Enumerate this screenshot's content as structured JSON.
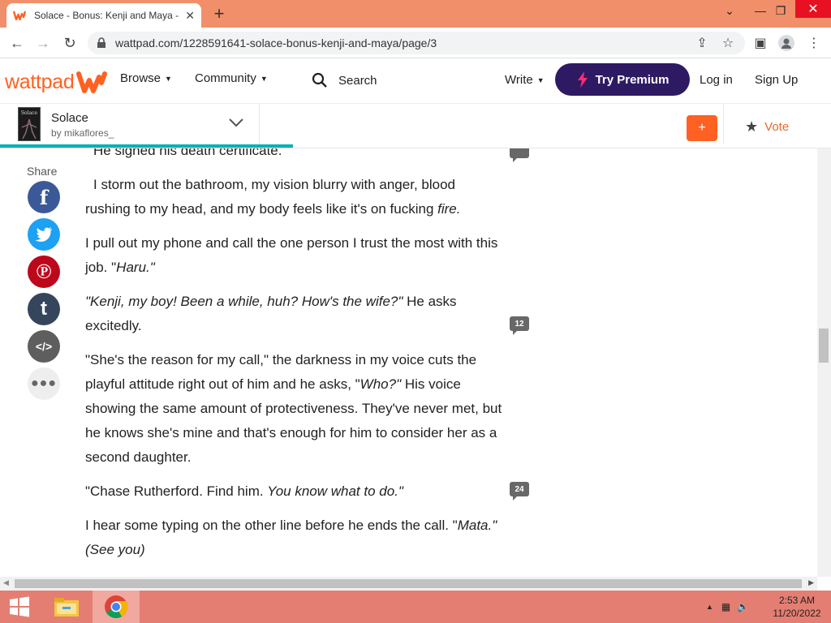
{
  "browser": {
    "tab_title": "Solace - Bonus: Kenji and Maya -",
    "tab_close": "✕",
    "new_tab": "+",
    "url": "wattpad.com/1228591641-solace-bonus-kenji-and-maya/page/3"
  },
  "header": {
    "logo": "wattpad",
    "browse": "Browse",
    "community": "Community",
    "search": "Search",
    "write": "Write",
    "premium": "Try Premium",
    "login": "Log in",
    "signup": "Sign Up"
  },
  "story": {
    "title": "Solace",
    "cover_text": "Solace",
    "author": "by mikaflores_",
    "plus": "+",
    "vote": "Vote",
    "reading_progress": 0.353
  },
  "share": {
    "label": "Share"
  },
  "paragraphs": {
    "p0": "He signed his death certificate.",
    "p1a": "I storm out the bathroom, my vision blurry with anger, blood rushing to my head, and my body feels like it's on fucking ",
    "p1b": "fire.",
    "p2a": "I pull out my phone and call the one person I trust the most with this job. \"",
    "p2b": "Haru.\"",
    "p3a": "\"Kenji, my boy! Been a while, huh? How's the wife?\"",
    "p3b": " He asks excitedly.",
    "p4a": "\"She's the reason for my call,\" the darkness in my voice cuts the playful attitude right out of him and he asks, \"",
    "p4b": "Who?\"",
    "p4c": " His voice showing the same amount of protectiveness. They've never met, but he knows she's mine and that's enough for him to consider her as a second daughter.",
    "p5a": "\"Chase Rutherford. Find him. ",
    "p5b": "You know what to do.\"",
    "p6a": "I hear some typing on the other line before he ends the call. \"",
    "p6b": "Mata.\"",
    "p6c": "(See you)"
  },
  "comments": {
    "c1": "12",
    "c2": "24"
  },
  "taskbar": {
    "time": "2:53 AM",
    "date": "11/20/2022"
  }
}
